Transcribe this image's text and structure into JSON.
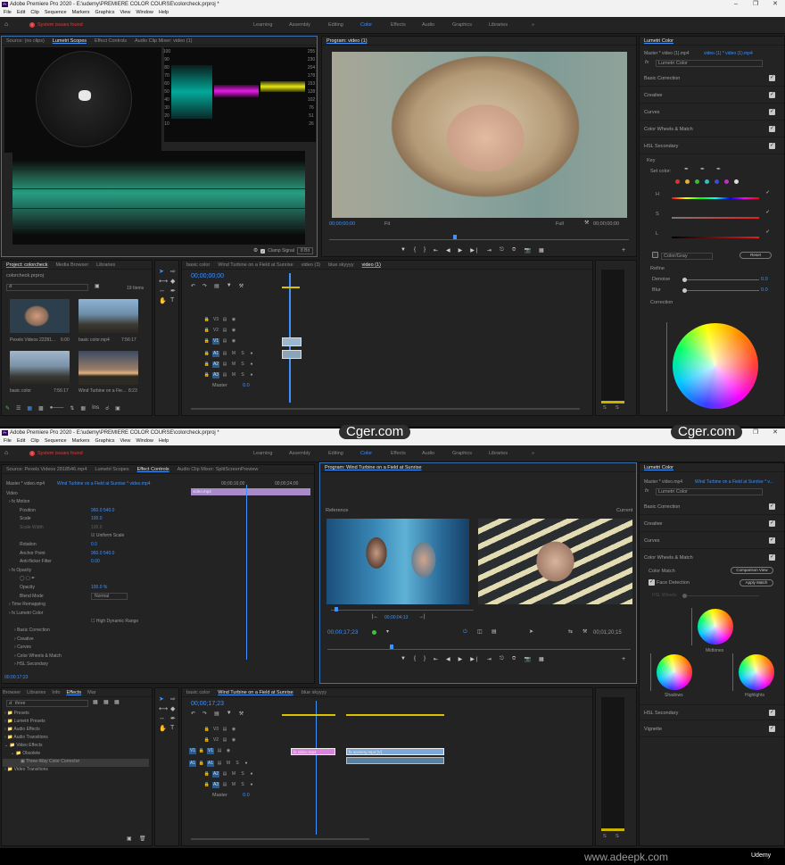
{
  "top": {
    "title": "Adobe Premiere Pro 2020 - E:\\udemy\\PREMIERE COLOR COURSE\\colorcheck.prproj *",
    "menu": [
      "File",
      "Edit",
      "Clip",
      "Sequence",
      "Markers",
      "Graphics",
      "View",
      "Window",
      "Help"
    ],
    "error": "System issues found",
    "workspaces": [
      "Learning",
      "Assembly",
      "Editing",
      "Color",
      "Effects",
      "Audio",
      "Graphics",
      "Libraries"
    ],
    "active_workspace": "Color",
    "source_tabs": [
      "Source: (no clips)",
      "Lumetri Scopes",
      "Effect Controls",
      "Audio Clip Mixer: video (1)"
    ],
    "scope_scale": [
      "100",
      "90",
      "80",
      "70",
      "60",
      "50",
      "40",
      "30",
      "20",
      "10",
      "0"
    ],
    "scope_scale_r": [
      "255",
      "230",
      "204",
      "178",
      "153",
      "128",
      "102",
      "76",
      "51",
      "26",
      "0"
    ],
    "clamp_signal": "Clamp Signal",
    "bit_depth": "8 Bit",
    "program_title": "Program: video (1)",
    "program_tc_in": "00;00;00;00",
    "program_tc_out": "00;00;00;00",
    "fit": "Fit",
    "full": "Full",
    "project_tabs": [
      "Project: colorcheck",
      "Media Browser",
      "Libraries"
    ],
    "project_file": "colorcheck.prproj",
    "item_count": "19 Items",
    "bins": [
      {
        "name": "Pexels Videos 22281...",
        "dur": "6:00"
      },
      {
        "name": "basic color.mp4",
        "dur": "7:56:17"
      },
      {
        "name": "basic color",
        "dur": "7:56:17"
      },
      {
        "name": "Wind Turbine on a Fie...",
        "dur": "8:23"
      }
    ],
    "timeline_tabs": [
      "basic color",
      "Wind Turbine on a Field at Sunrise",
      "video (3)",
      "blue skyyyy",
      "video (1)"
    ],
    "timeline_tc": "00;00;00;00",
    "tracks_v": [
      "V3",
      "V2",
      "V1"
    ],
    "tracks_a": [
      "A1",
      "A2",
      "A3"
    ],
    "master": "Master",
    "master_val": "0.0",
    "lumetri_title": "Lumetri Color",
    "lumetri_master": "Master * video (1).mp4",
    "lumetri_clip": "video (1) * video (1).mp4",
    "lumetri_fx": "Lumetri Color",
    "lumetri_sections": [
      "Basic Correction",
      "Creative",
      "Curves",
      "Color Wheels & Match",
      "HSL Secondary"
    ],
    "key_label": "Key",
    "set_color": "Set color:",
    "hsl_letters": [
      "H",
      "S",
      "L"
    ],
    "color_gray": "Color/Gray",
    "reset": "Reset",
    "refine": "Refine",
    "denoise": "Denoise",
    "denoise_val": "0.0",
    "blur": "Blur",
    "blur_val": "0.0",
    "correction": "Correction",
    "bin_zoom": "Ins",
    "meter_labels": [
      "S",
      "S"
    ]
  },
  "bottom": {
    "title": "Adobe Premiere Pro 2020 - E:\\udemy\\PREMIERE COLOR COURSE\\colorcheck.prproj *",
    "error": "System issues found",
    "source_tabs": [
      "Source: Pexels Videos 2818546.mp4",
      "Lumetri Scopes",
      "Effect Controls",
      "Audio Clip Mixer: SplitScreenPreview"
    ],
    "ec_master": "Master * video.mp4",
    "ec_clip": "Wind Turbine on a Field at Sunrise * video.mp4",
    "ec_tc1": "00;00;16;00",
    "ec_tc2": "00;00;24;00",
    "ec_clipname": "video.mp4",
    "ec_video": "Video",
    "ec_rows": [
      {
        "name": "Motion",
        "val": "",
        "fx": true
      },
      {
        "name": "Position",
        "val": "960.0   540.0"
      },
      {
        "name": "Scale",
        "val": "100.0"
      },
      {
        "name": "Scale Width",
        "val": "100.0"
      },
      {
        "name": "",
        "val": "Uniform Scale"
      },
      {
        "name": "Rotation",
        "val": "0.0"
      },
      {
        "name": "Anchor Point",
        "val": "960.0   540.0"
      },
      {
        "name": "Anti-flicker Filter",
        "val": "0.00"
      },
      {
        "name": "Opacity",
        "val": "",
        "fx": true
      },
      {
        "name": "",
        "val": ""
      },
      {
        "name": "Opacity",
        "val": "100.0 %"
      },
      {
        "name": "Blend Mode",
        "val": "Normal"
      },
      {
        "name": "Time Remapping",
        "val": ""
      },
      {
        "name": "Lumetri Color",
        "val": "",
        "fx": true
      },
      {
        "name": "",
        "val": "High Dynamic Range"
      },
      {
        "name": "Basic Correction",
        "val": ""
      },
      {
        "name": "Creative",
        "val": ""
      },
      {
        "name": "Curves",
        "val": ""
      },
      {
        "name": "Color Wheels & Match",
        "val": ""
      },
      {
        "name": "HSL Secondary",
        "val": ""
      }
    ],
    "ec_footer_tc": "00;00;17;23",
    "program_title": "Program: Wind Turbine on a Field at Sunrise",
    "reference": "Reference",
    "current": "Current",
    "ref_tc": "00;00;04;13",
    "program_tc_in": "00;00;17;23",
    "program_tc_out": "00;01;20;15",
    "lumetri_title": "Lumetri Color",
    "lumetri_master": "Master * video.mp4",
    "lumetri_clip": "Wind Turbine on a Field at Sunrise * v...",
    "lumetri_fx": "Lumetri Color",
    "lumetri_sections": [
      "Basic Correction",
      "Creative",
      "Curves",
      "Color Wheels & Match"
    ],
    "color_match": "Color Match",
    "comparison_view": "Comparison View",
    "face_detection": "Face Detection",
    "apply_match": "Apply Match",
    "hsl_wheels_label": "HSL Wheels",
    "wheels": [
      "Midtones",
      "Shadows",
      "Highlights"
    ],
    "lumetri_sections2": [
      "HSL Secondary",
      "Vignette"
    ],
    "effects_tabs": [
      "Browser",
      "Libraries",
      "Info",
      "Effects",
      "Mar"
    ],
    "effects_search": "three",
    "effects_tree": [
      "Presets",
      "Lumetri Presets",
      "Audio Effects",
      "Audio Transitions",
      "Video Effects",
      "Obsolete",
      "Three-Way Color Corrector",
      "Video Transitions"
    ],
    "timeline_tabs": [
      "basic color",
      "Wind Turbine on a Field at Sunrise",
      "blue skyyyy"
    ],
    "timeline_tc": "00;00;17;23",
    "tracks_v": [
      "V3",
      "V2",
      "V1"
    ],
    "tracks_a": [
      "A1",
      "A2",
      "A3"
    ],
    "master": "Master",
    "master_val": "0.0",
    "clip1": "video.mp4",
    "clip2": "scenery.mp4 [V]",
    "meter_labels": [
      "S",
      "S"
    ]
  },
  "watermark": "Cger.com",
  "footer_site": "www.adeepk.com",
  "footer_brand": "Udemy"
}
